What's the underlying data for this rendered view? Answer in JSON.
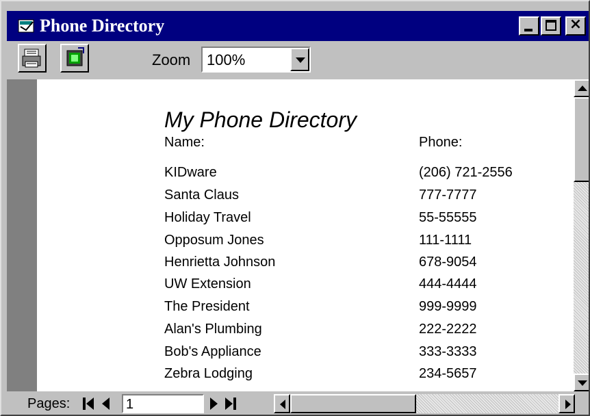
{
  "window": {
    "title": "Phone Directory",
    "controls": {
      "minimize": "minimize-icon",
      "maximize": "maximize-icon",
      "close": "×"
    }
  },
  "toolbar": {
    "print_icon": "printer-icon",
    "preview_icon": "page-setup-icon",
    "zoom_label": "Zoom",
    "zoom_value": "100%"
  },
  "document": {
    "title": "My Phone Directory",
    "name_header": "Name:",
    "phone_header": "Phone:",
    "entries": [
      {
        "name": "KIDware",
        "phone": "(206) 721-2556"
      },
      {
        "name": "Santa Claus",
        "phone": "777-7777"
      },
      {
        "name": "Holiday Travel",
        "phone": "55-55555"
      },
      {
        "name": "Opposum Jones",
        "phone": "111-1111"
      },
      {
        "name": "Henrietta Johnson",
        "phone": "678-9054"
      },
      {
        "name": "UW Extension",
        "phone": "444-4444"
      },
      {
        "name": "The President",
        "phone": "999-9999"
      },
      {
        "name": "Alan's Plumbing",
        "phone": "222-2222"
      },
      {
        "name": "Bob's Appliance",
        "phone": "333-3333"
      },
      {
        "name": "Zebra Lodging",
        "phone": "234-5657"
      }
    ]
  },
  "statusbar": {
    "pages_label": "Pages:",
    "page_value": "1"
  },
  "colors": {
    "titlebar": "#000080",
    "chrome": "#c0c0c0",
    "page": "#ffffff"
  }
}
